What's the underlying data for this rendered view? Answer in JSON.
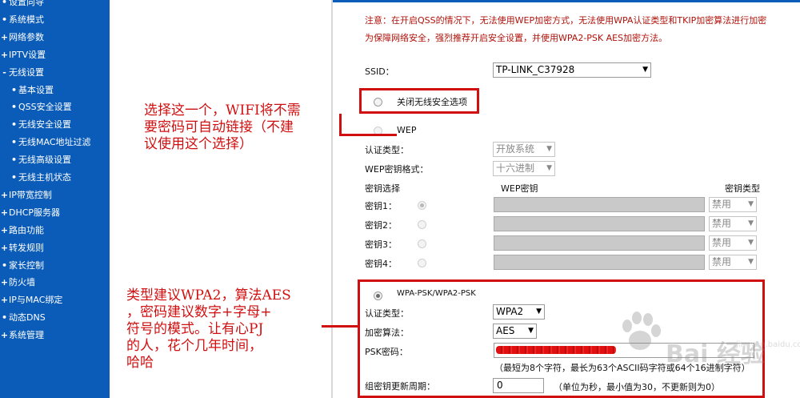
{
  "sidebar": {
    "items": [
      {
        "bullet": "•",
        "label": "设置向导"
      },
      {
        "bullet": "•",
        "label": "系统模式"
      },
      {
        "bullet": "+",
        "label": "网络参数"
      },
      {
        "bullet": "+",
        "label": "IPTV设置"
      },
      {
        "bullet": "-",
        "label": "无线设置"
      },
      {
        "bullet": "•",
        "label": "基本设置",
        "sub": true
      },
      {
        "bullet": "•",
        "label": "QSS安全设置",
        "sub": true
      },
      {
        "bullet": "•",
        "label": "无线安全设置",
        "sub": true
      },
      {
        "bullet": "•",
        "label": "无线MAC地址过滤",
        "sub": true
      },
      {
        "bullet": "•",
        "label": "无线高级设置",
        "sub": true
      },
      {
        "bullet": "•",
        "label": "无线主机状态",
        "sub": true
      },
      {
        "bullet": "+",
        "label": "IP带宽控制"
      },
      {
        "bullet": "+",
        "label": "DHCP服务器"
      },
      {
        "bullet": "+",
        "label": "路由功能"
      },
      {
        "bullet": "+",
        "label": "转发规则"
      },
      {
        "bullet": "•",
        "label": "家长控制"
      },
      {
        "bullet": "+",
        "label": "防火墙"
      },
      {
        "bullet": "+",
        "label": "IP与MAC绑定"
      },
      {
        "bullet": "•",
        "label": "动态DNS"
      },
      {
        "bullet": "+",
        "label": "系统管理"
      }
    ]
  },
  "notice": {
    "line1": "注意：在开启QSS的情况下，无法使用WEP加密方式，无法使用WPA认证类型和TKIP加密算法进行加密",
    "line2": "为保障网络安全，强烈推荐开启安全设置，并使用WPA2-PSK AES加密方法。"
  },
  "ssid": {
    "label": "SSID：",
    "value": "TP-LINK_C37928"
  },
  "disable_security": {
    "label": "关闭无线安全选项"
  },
  "wep": {
    "label": "WEP",
    "auth_label": "认证类型：",
    "auth_value": "开放系统",
    "format_label": "WEP密钥格式：",
    "format_value": "十六进制",
    "col_key_select": "密钥选择",
    "col_key": "WEP密钥",
    "col_type": "密钥类型",
    "keys": [
      {
        "label": "密钥1：",
        "type": "禁用"
      },
      {
        "label": "密钥2：",
        "type": "禁用"
      },
      {
        "label": "密钥3：",
        "type": "禁用"
      },
      {
        "label": "密钥4：",
        "type": "禁用"
      }
    ]
  },
  "wpa": {
    "label": "WPA-PSK/WPA2-PSK",
    "auth_label": "认证类型：",
    "auth_value": "WPA2",
    "cipher_label": "加密算法：",
    "cipher_value": "AES",
    "psk_label": "PSK密码：",
    "psk_hint": "（最短为8个字符，最长为63个ASCII码字符或64个16进制字符）",
    "group_label": "组密钥更新周期：",
    "group_value": "0",
    "group_hint": "（单位为秒，最小值为30，不更新则为0）"
  },
  "annotations": {
    "a1": [
      "选择这一个，WIFI将不需",
      "要密码可自动链接（不建",
      "议使用这个选择）"
    ],
    "a2": [
      "类型建议WPA2，算法AES",
      "，密码建议数字+字母+",
      "符号的模式。让有心PJ",
      "的人，花个几年时间，",
      "哈哈"
    ]
  },
  "watermark": {
    "text": "Bai 经验",
    "sub": "jingyan.baidu.com"
  }
}
